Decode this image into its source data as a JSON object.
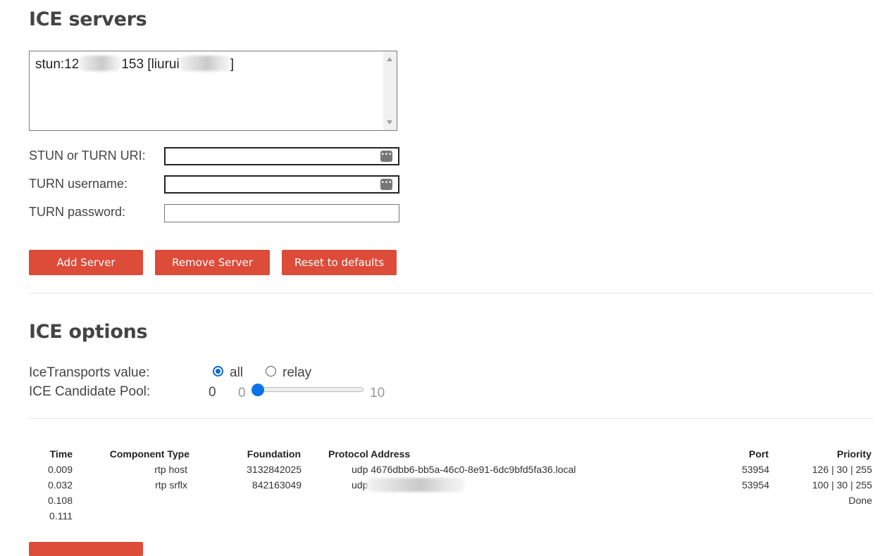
{
  "ice_servers": {
    "heading": "ICE servers",
    "server_list": {
      "item_prefix": "stun:12",
      "item_mid": "153 [liurui",
      "item_suffix": "]"
    },
    "fields": {
      "uri_label": "STUN or TURN URI:",
      "username_label": "TURN username:",
      "password_label": "TURN password:",
      "uri_value": "",
      "username_value": "",
      "password_value": ""
    },
    "buttons": {
      "add": "Add Server",
      "remove": "Remove Server",
      "reset": "Reset to defaults"
    },
    "button_color": "#dd4b39"
  },
  "ice_options": {
    "heading": "ICE options",
    "transports_label": "IceTransports value:",
    "transport_all": "all",
    "transport_relay": "relay",
    "transport_selected": "all",
    "pool_label": "ICE Candidate Pool:",
    "pool_value": "0",
    "pool_min": "0",
    "pool_max": "10"
  },
  "candidates_table": {
    "headers": {
      "time": "Time",
      "component": "Component Type",
      "foundation": "Foundation",
      "protocol_address": "Protocol Address",
      "port": "Port",
      "priority": "Priority"
    },
    "rows": [
      {
        "time": "0.009",
        "component": "rtp host",
        "foundation": "3132842025",
        "protocol_address": "udp 4676dbb6-bb5a-46c0-8e91-6dc9bfd5fa36.local",
        "port": "53954",
        "priority": "126 | 30 | 255"
      },
      {
        "time": "0.032",
        "component": "rtp srflx",
        "foundation": "842163049",
        "protocol_address": "udp",
        "port": "53954",
        "priority": "100 | 30 | 255"
      },
      {
        "time": "0.108",
        "component": "",
        "foundation": "",
        "protocol_address": "",
        "port": "",
        "priority": "Done"
      },
      {
        "time": "0.111",
        "component": "",
        "foundation": "",
        "protocol_address": "",
        "port": "",
        "priority": ""
      }
    ]
  }
}
